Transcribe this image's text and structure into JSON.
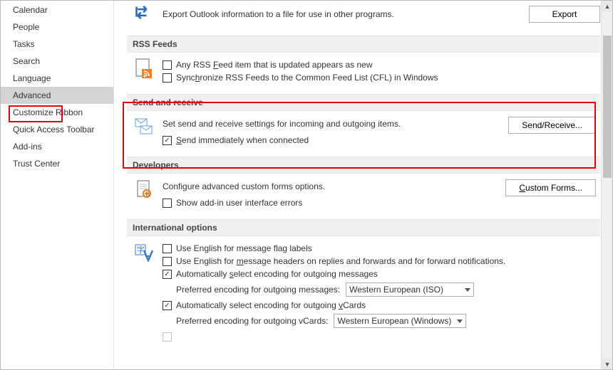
{
  "sidebar": {
    "items": [
      {
        "label": "Calendar"
      },
      {
        "label": "People"
      },
      {
        "label": "Tasks"
      },
      {
        "label": "Search"
      },
      {
        "label": "Language"
      },
      {
        "label": "Advanced"
      },
      {
        "label": "Customize Ribbon"
      },
      {
        "label": "Quick Access Toolbar"
      },
      {
        "label": "Add-ins"
      },
      {
        "label": "Trust Center"
      }
    ]
  },
  "export": {
    "desc": "Export Outlook information to a file for use in other programs.",
    "button": "Export"
  },
  "rss": {
    "header": "RSS Feeds",
    "cb1_pre": "Any RSS ",
    "cb1_u": "F",
    "cb1_post": "eed item that is updated appears as new",
    "cb2_pre": "Sync",
    "cb2_u": "h",
    "cb2_post": "ronize RSS Feeds to the Common Feed List (CFL) in Windows"
  },
  "sendrecv": {
    "header": "Send and receive",
    "desc": "Set send and receive settings for incoming and outgoing items.",
    "button": "Send/Receive...",
    "cb_u": "S",
    "cb_post": "end immediately when connected"
  },
  "dev": {
    "header": "Developers",
    "desc": "Configure advanced custom forms options.",
    "button_u": "C",
    "button_post": "ustom Forms...",
    "cb": "Show add-in user interface errors"
  },
  "intl": {
    "header": "International options",
    "cb1": "Use English for message flag labels",
    "cb2_pre": "Use English for ",
    "cb2_u": "m",
    "cb2_post": "essage headers on replies and forwards and for forward notifications.",
    "cb3_pre": "Automatically ",
    "cb3_u": "s",
    "cb3_post": "elect encoding for outgoing messages",
    "sel1_label": "Preferred encoding for outgoing messages:",
    "sel1_value": "Western European (ISO)",
    "cb4_pre": "Automatically select encoding for outgoing ",
    "cb4_u": "v",
    "cb4_post": "Cards",
    "sel2_label": "Preferred encoding for outgoing vCards:",
    "sel2_value": "Western European (Windows)"
  }
}
